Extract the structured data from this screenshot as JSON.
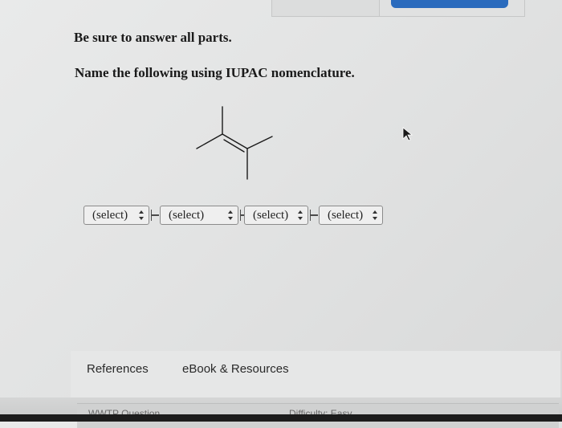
{
  "instructions": {
    "line1": "Be sure to answer all parts.",
    "line2": "Name the following using IUPAC nomenclature."
  },
  "selects": [
    {
      "value": "(select)"
    },
    {
      "value": "(select)"
    },
    {
      "value": "(select)"
    },
    {
      "value": "(select)"
    }
  ],
  "tabs": {
    "references": "References",
    "ebook": "eBook & Resources"
  },
  "bottom": {
    "left_text": "WWTP Question",
    "right_text": "Difficulty: Easy"
  },
  "colors": {
    "accent_blue": "#2a6bbd",
    "bond_line": "#1a1a1a"
  },
  "icons": [
    "mouse-cursor-icon",
    "select-arrows-icon"
  ]
}
